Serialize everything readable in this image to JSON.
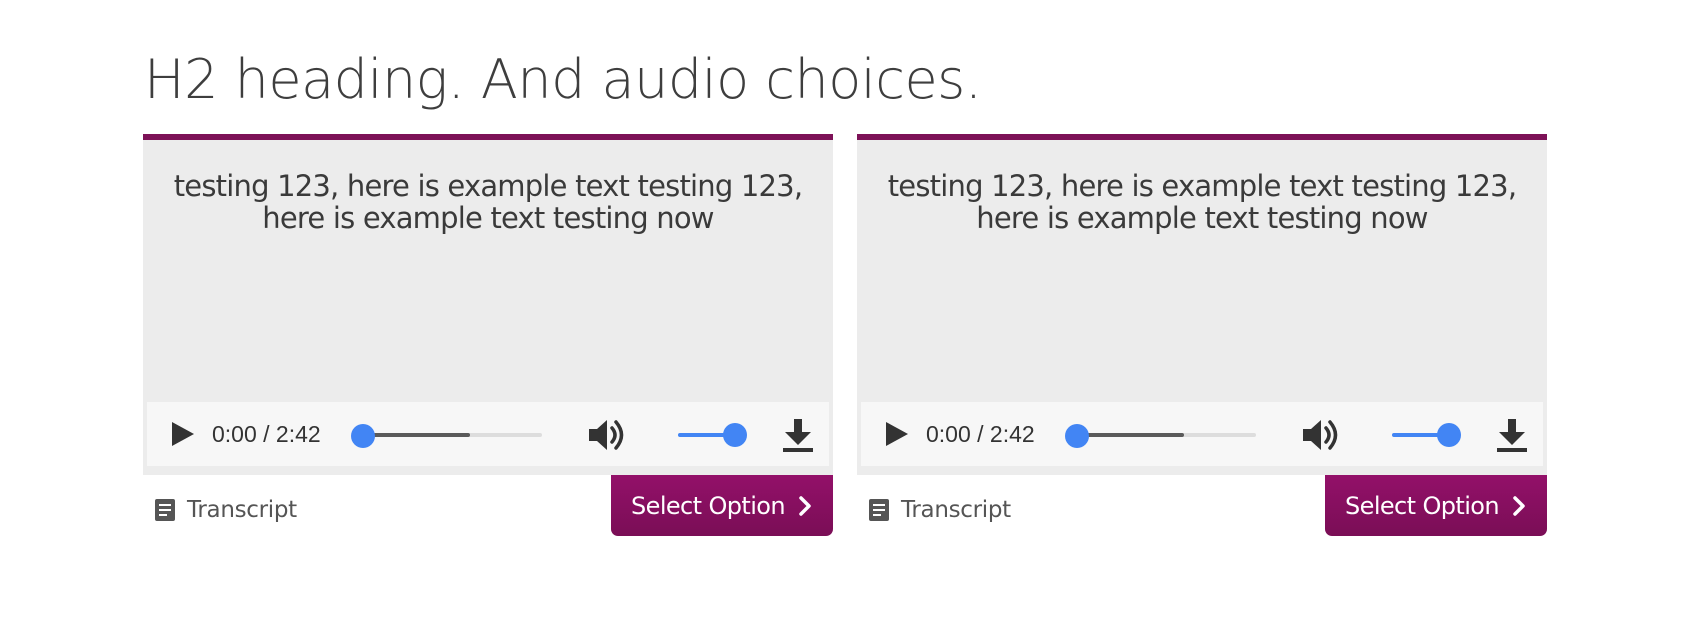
{
  "heading": "H2 heading. And audio choices.",
  "colors": {
    "accent": "#7d1257",
    "player_progress": "#4285f4",
    "panel_bg": "#ececec"
  },
  "cards": [
    {
      "text": "testing 123, here is example text testing 123, here is example text testing now",
      "player": {
        "time": "0:00 / 2:42",
        "progress": 0,
        "volume": 1,
        "icons": [
          "play-icon",
          "volume-icon",
          "download-icon"
        ]
      },
      "transcript_label": "Transcript",
      "transcript_icon": "document-icon",
      "select_label": "Select Option",
      "select_icon": "chevron-right-icon"
    },
    {
      "text": "testing 123, here is example text testing 123, here is example text testing now",
      "player": {
        "time": "0:00 / 2:42",
        "progress": 0,
        "volume": 1,
        "icons": [
          "play-icon",
          "volume-icon",
          "download-icon"
        ]
      },
      "transcript_label": "Transcript",
      "transcript_icon": "document-icon",
      "select_label": "Select Option",
      "select_icon": "chevron-right-icon"
    }
  ]
}
